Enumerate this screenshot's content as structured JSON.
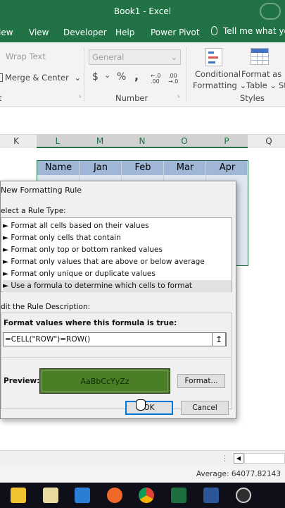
{
  "window": {
    "title": "Book1  -  Excel"
  },
  "ribbon_tabs": [
    "iew",
    "View",
    "Developer",
    "Help",
    "Power Pivot"
  ],
  "tell_me": "Tell me what you",
  "ribbon": {
    "wrap_text": "Wrap Text",
    "merge_center": "Merge & Center",
    "number_format": "General",
    "currency": "$",
    "percent": "%",
    "comma": ",",
    "inc_decimal": "←.0 .00",
    "dec_decimal": ".00 →.0",
    "group_number": "Number",
    "group_styles": "Styles",
    "group_alignment": "t",
    "cond_format_1": "Conditional",
    "cond_format_2": "Formatting",
    "format_table_1": "Format as",
    "format_table_2": "Table",
    "cell_styles": "Styl"
  },
  "columns": [
    "K",
    "L",
    "M",
    "N",
    "O",
    "P",
    "Q"
  ],
  "table": {
    "headers": [
      "Name",
      "Jan",
      "Feb",
      "Mar",
      "Apr"
    ]
  },
  "dialog": {
    "title": "New Formatting Rule",
    "select_rule_type": "elect a Rule Type:",
    "rule_types": [
      "Format all cells based on their values",
      "Format only cells that contain",
      "Format only top or bottom ranked values",
      "Format only values that are above or below average",
      "Format only unique or duplicate values",
      "Use a formula to determine which cells to format"
    ],
    "selected_rule_index": 5,
    "edit_description": "dit the Rule Description:",
    "formula_label": "Format values where this formula is true:",
    "formula_value": "=CELL(\"ROW\")=ROW()",
    "preview_label": "Preview:",
    "preview_text": "AaBbCcYyZz",
    "preview_fill": "#4a7f25",
    "format_button": "Format...",
    "ok_button": "OK",
    "cancel_button": "Cancel"
  },
  "status": {
    "average": "Average: 64077.82143"
  },
  "taskbar_icons": [
    "file-explorer-icon",
    "file-folder-icon",
    "mail-icon",
    "firefox-icon",
    "chrome-icon",
    "excel-icon",
    "word-icon",
    "obs-icon"
  ],
  "colors": {
    "excel_green": "#217346",
    "table_header": "#9fb6d6",
    "table_body": "#dfe7f1"
  }
}
